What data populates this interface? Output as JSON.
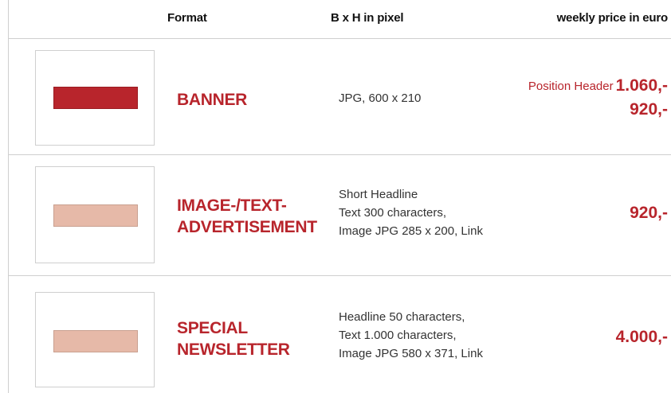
{
  "header": {
    "format": "Format",
    "size": "B x H in pixel",
    "price": "weekly price in euro"
  },
  "colors": {
    "accent": "#b8252c",
    "swatch_light": "#e6b9a8",
    "border": "#cfcfcf"
  },
  "rows": [
    {
      "format": [
        "BANNER"
      ],
      "description": [
        "JPG, 600 x 210"
      ],
      "position_label": "Position Header",
      "prices": [
        "1.060,-",
        "920,-"
      ]
    },
    {
      "format": [
        "IMAGE-/TEXT-",
        "ADVERTISEMENT"
      ],
      "description": [
        "Short Headline",
        "Text 300 characters,",
        "Image JPG 285 x 200, Link"
      ],
      "prices": [
        "920,-"
      ]
    },
    {
      "format": [
        "SPECIAL",
        "NEWSLETTER"
      ],
      "description": [
        "Headline 50 characters,",
        "Text 1.000 characters,",
        "Image JPG 580 x 371, Link"
      ],
      "prices": [
        "4.000,-"
      ]
    }
  ]
}
